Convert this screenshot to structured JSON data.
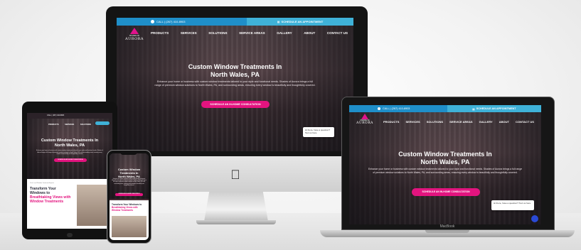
{
  "site": {
    "call_label": "CALL | (267) 410-8903",
    "appointment_label": "SCHEDULE AN APPOINTMENT",
    "logo_brand": "AURORA",
    "logo_tagline": "SHADES OF",
    "nav": [
      "PRODUCTS",
      "SERVICES",
      "SOLUTIONS",
      "SERVICE AREAS",
      "GALLERY",
      "ABOUT",
      "CONTACT US"
    ],
    "hero_title_line1": "Custom Window Treatments In",
    "hero_title_line2": "North Wales, PA",
    "hero_text": "Enhance your home or business with custom window treatments tailored to your style and functional needs. Shades of Aurora brings a full range of premium window solutions to North Wales, PA, and surrounding areas, ensuring every window is beautifully and thoughtfully covered.",
    "cta_label": "SCHEDULE AN IN-HOME CONSULTATION",
    "chat_text": "Hi there, have a question? Text us here."
  },
  "tablet": {
    "section_kicker": "Your Local Window Treatment Experts",
    "section_title_1": "Transform Your",
    "section_title_2": "Windows to",
    "section_title_pink": "Breathtaking Views with Window Treatments"
  },
  "phone": {
    "section_title_1": "Transform Your Windows to",
    "section_title_pink": "Breathtaking Views with Window Treatments"
  },
  "devices": {
    "laptop_label": "MacBook"
  },
  "colors": {
    "accent_pink": "#e3147f",
    "topbar_blue": "#1f8fc9",
    "topbar_light_blue": "#3fb2d8"
  }
}
